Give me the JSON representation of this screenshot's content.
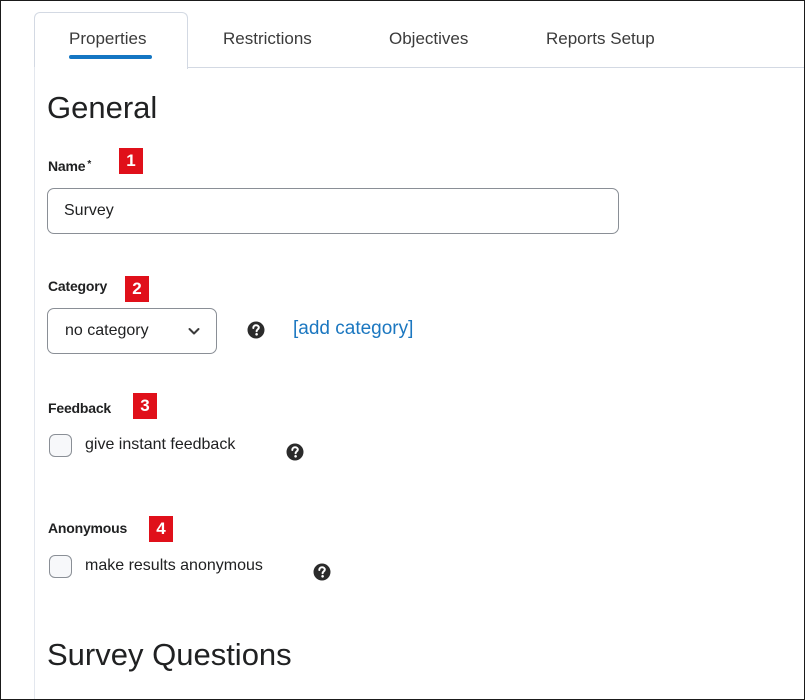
{
  "tabs": [
    {
      "label": "Properties",
      "active": true
    },
    {
      "label": "Restrictions",
      "active": false
    },
    {
      "label": "Objectives",
      "active": false
    },
    {
      "label": "Reports Setup",
      "active": false
    }
  ],
  "general_heading": "General",
  "name_field": {
    "label": "Name",
    "required_mark": "*",
    "value": "Survey",
    "badge": "1"
  },
  "category_field": {
    "label": "Category",
    "selected": "no category",
    "add_link": "[add category]",
    "badge": "2"
  },
  "feedback_field": {
    "label": "Feedback",
    "checkbox_label": "give instant feedback",
    "checked": false,
    "badge": "3"
  },
  "anonymous_field": {
    "label": "Anonymous",
    "checkbox_label": "make results anonymous",
    "checked": false,
    "badge": "4"
  },
  "survey_questions_heading": "Survey Questions",
  "colors": {
    "accent": "#1476c3",
    "link": "#1b77c0",
    "badge": "#e0101a",
    "border": "#8a8f96"
  }
}
